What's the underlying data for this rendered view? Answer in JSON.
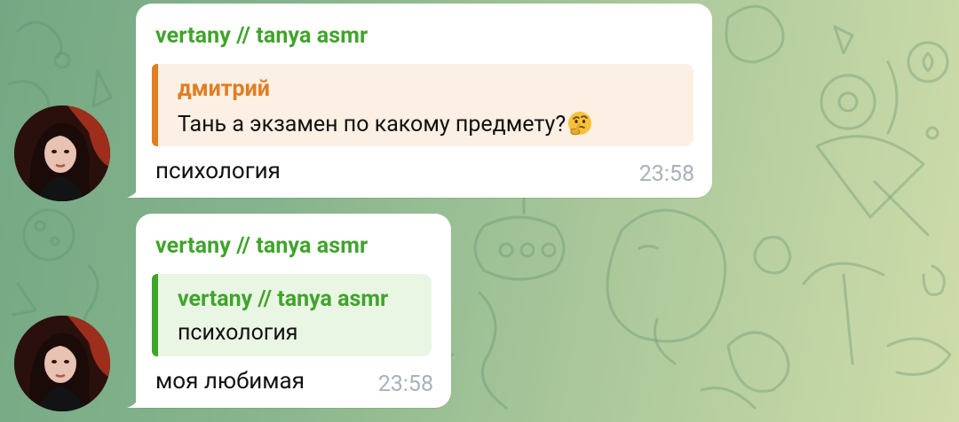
{
  "chat": {
    "messages": [
      {
        "sender": "vertany // tanya asmr",
        "reply": {
          "name": "дмитрий",
          "text": "Тань а экзамен по какому предмету?",
          "emoji": "thinking-face-icon"
        },
        "text": "психология",
        "time": "23:58",
        "avatar": "avatar-icon"
      },
      {
        "sender": "vertany // tanya asmr",
        "reply": {
          "name": "vertany // tanya asmr",
          "text": "психология"
        },
        "text": "моя любимая",
        "time": "23:58",
        "avatar": "avatar-icon"
      }
    ]
  },
  "colors": {
    "sender_name": "#3fa42b",
    "reply_quote_orange": "#e07e22",
    "reply_bg_orange": "#fcefe4",
    "reply_bg_green": "#eaf6e4",
    "time": "#a7b2bc",
    "bubble": "#ffffff"
  }
}
